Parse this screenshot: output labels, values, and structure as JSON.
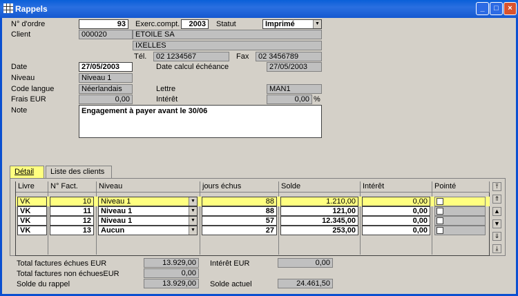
{
  "window": {
    "title": "Rappels",
    "min": "_",
    "max": "□",
    "close": "×"
  },
  "header": {
    "no_ordre_label": "N° d'ordre",
    "no_ordre": "93",
    "exerc_label": "Exerc.compt.",
    "exerc": "2003",
    "statut_label": "Statut",
    "statut": "Imprimé",
    "client_label": "Client",
    "client_code": "000020",
    "client_name": "ETOILE SA",
    "client_city": "IXELLES",
    "tel_label": "Tél.",
    "tel": "02 1234567",
    "fax_label": "Fax",
    "fax": "02 3456789",
    "date_label": "Date",
    "date": "27/05/2003",
    "date_calc_label": "Date calcul échéance",
    "date_calc": "27/05/2003",
    "niveau_label": "Niveau",
    "niveau": "Niveau 1",
    "code_langue_label": "Code langue",
    "code_langue": "Néerlandais",
    "lettre_label": "Lettre",
    "lettre": "MAN1",
    "frais_label": "Frais EUR",
    "frais": "0,00",
    "interet_label": "Intérêt",
    "interet": "0,00",
    "pct": "%",
    "note_label": "Note",
    "note": "Engagement à payer avant le 30/06"
  },
  "tabs": [
    {
      "label": "Détail"
    },
    {
      "label": "Liste des clients"
    }
  ],
  "table": {
    "columns": [
      "Livre",
      "N° Fact.",
      "Niveau",
      "jours échus",
      "Solde",
      "Intérêt",
      "Pointé"
    ],
    "rows": [
      {
        "livre": "VK",
        "fact": "10",
        "niveau": "Niveau 1",
        "jours": "88",
        "solde": "1.210,00",
        "interet": "0,00"
      },
      {
        "livre": "VK",
        "fact": "11",
        "niveau": "Niveau 1",
        "jours": "88",
        "solde": "121,00",
        "interet": "0,00"
      },
      {
        "livre": "VK",
        "fact": "12",
        "niveau": "Niveau 1",
        "jours": "57",
        "solde": "12.345,00",
        "interet": "0,00"
      },
      {
        "livre": "VK",
        "fact": "13",
        "niveau": "Aucun",
        "jours": "27",
        "solde": "253,00",
        "interet": "0,00"
      }
    ]
  },
  "totals": {
    "echues_label": "Total factures échues EUR",
    "echues": "13.929,00",
    "non_echues_label": "Total factures non échuesEUR",
    "non_echues": "0,00",
    "solde_rappel_label": "Solde du rappel",
    "solde_rappel": "13.929,00",
    "interet_eur_label": "Intérêt EUR",
    "interet_eur": "0,00",
    "solde_actuel_label": "Solde actuel",
    "solde_actuel": "24.461,50"
  },
  "colors": {
    "title_blue": "#0a5fd8",
    "selected_row": "#ffff80",
    "dialog_bg": "#d4d0c8"
  }
}
